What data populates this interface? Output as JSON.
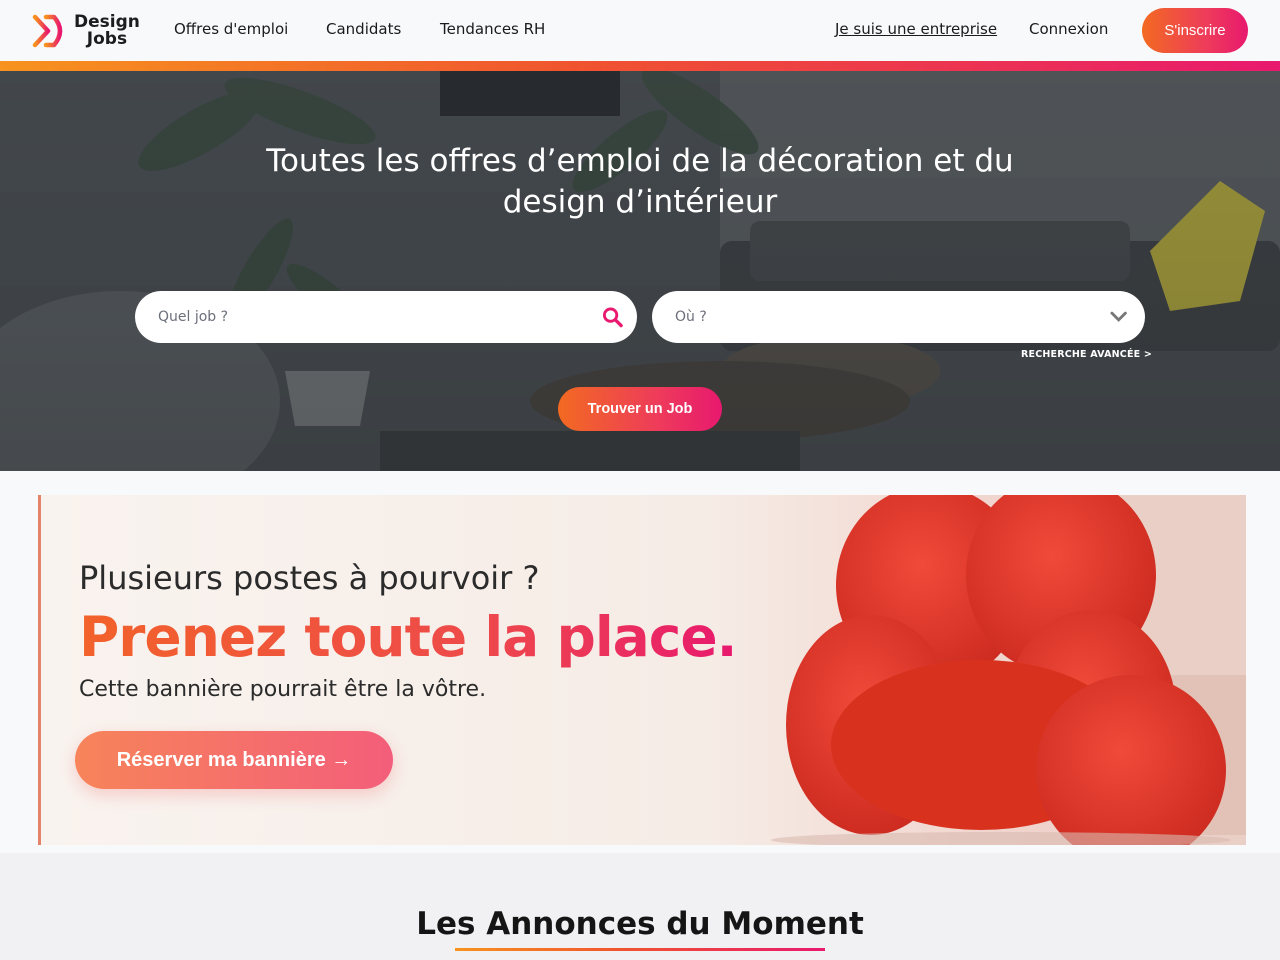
{
  "brand": {
    "logo_line1": "Design",
    "logo_line2": "Jobs",
    "logo_icon": "chevron-logo-icon"
  },
  "nav": {
    "items": [
      {
        "label": "Offres d'emploi"
      },
      {
        "label": "Candidats"
      },
      {
        "label": "Tendances RH"
      }
    ],
    "company_link": "Je suis une entreprise",
    "login": "Connexion",
    "signup": "S'inscrire"
  },
  "hero": {
    "title": "Toutes les offres d’emploi de la décoration et du design d’intérieur",
    "job_placeholder": "Quel job ?",
    "where_placeholder": "Où ?",
    "advanced_search": "RECHERCHE AVANCÉE >",
    "find_button": "Trouver un Job",
    "search_icon": "search-icon",
    "dropdown_icon": "chevron-down-icon"
  },
  "banner": {
    "line1": "Plusieurs postes à pourvoir ?",
    "line2": "Prenez toute la place.",
    "line3": "Cette bannière pourrait être la vôtre.",
    "cta": "Réserver ma bannière →"
  },
  "section": {
    "title": "Les Annonces du Moment"
  },
  "colors": {
    "accent_orange": "#f26a21",
    "accent_pink": "#e8196e",
    "header_bg": "#f8f9fb"
  }
}
